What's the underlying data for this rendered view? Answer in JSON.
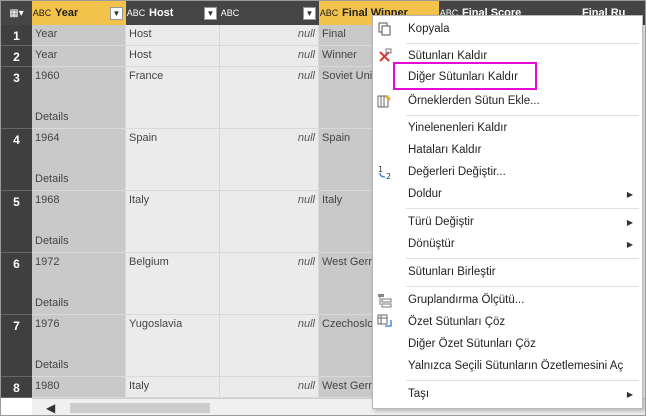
{
  "columns": [
    {
      "name": "Year",
      "type_icon": "ABC"
    },
    {
      "name": "Host",
      "type_icon": "ABC"
    },
    {
      "name": "",
      "type_icon": "ABC"
    },
    {
      "name": "Final Winner",
      "type_icon": "ABC"
    },
    {
      "name": "Final Score",
      "type_icon": "ABC"
    },
    {
      "name": "Final Ru",
      "type_icon": ""
    }
  ],
  "rows": [
    {
      "num": "1",
      "year": "Year",
      "host": "Host",
      "col3": "null",
      "winner": "Final",
      "details": ""
    },
    {
      "num": "2",
      "year": "Year",
      "host": "Host",
      "col3": "null",
      "winner": "Winner",
      "details": ""
    },
    {
      "num": "3",
      "year": "1960",
      "host": "France",
      "col3": "null",
      "winner": "Soviet Uni",
      "details": "Details"
    },
    {
      "num": "4",
      "year": "1964",
      "host": "Spain",
      "col3": "null",
      "winner": "Spain",
      "details": "Details"
    },
    {
      "num": "5",
      "year": "1968",
      "host": "Italy",
      "col3": "null",
      "winner": "Italy",
      "details": "Details"
    },
    {
      "num": "6",
      "year": "1972",
      "host": "Belgium",
      "col3": "null",
      "winner": "West Gern",
      "details": "Details"
    },
    {
      "num": "7",
      "year": "1976",
      "host": "Yugoslavia",
      "col3": "null",
      "winner": "Czechoslo",
      "details": "Details"
    },
    {
      "num": "8",
      "year": "1980",
      "host": "Italy",
      "col3": "null",
      "winner": "West Gern",
      "details": ""
    }
  ],
  "menu": {
    "copy": "Kopyala",
    "remove_columns": "Sütunları Kaldır",
    "remove_other_columns": "Diğer Sütunları Kaldır",
    "add_column_from_examples": "Örneklerden Sütun Ekle...",
    "remove_duplicates": "Yinelenenleri Kaldır",
    "remove_errors": "Hataları Kaldır",
    "replace_values": "Değerleri Değiştir...",
    "fill": "Doldur",
    "change_type": "Türü Değiştir",
    "transform": "Dönüştür",
    "merge_columns": "Sütunları Birleştir",
    "group_by": "Gruplandırma Ölçütü...",
    "unpivot_columns": "Özet Sütunları Çöz",
    "unpivot_other_columns": "Diğer Özet Sütunları Çöz",
    "unpivot_only_selected": "Yalnızca Seçili Sütunların Özetlemesini Aç",
    "move": "Taşı"
  },
  "colors": {
    "header": "#454545",
    "selected_header": "#f2c24b",
    "highlight": "#e40bd6"
  }
}
